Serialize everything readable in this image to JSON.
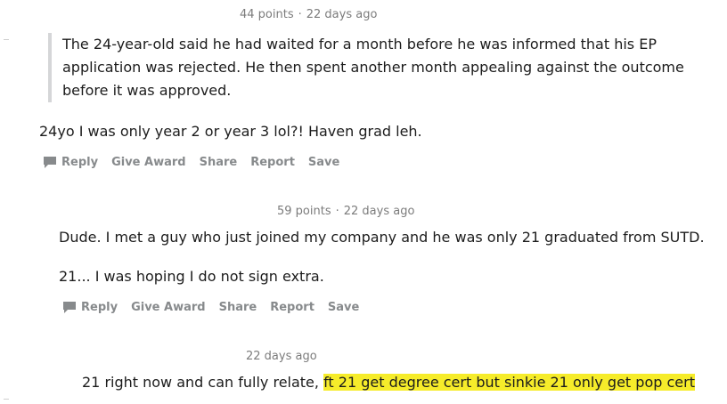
{
  "comments": [
    {
      "points": "44 points",
      "separator": "·",
      "time": "22 days ago",
      "quote": "The 24-year-old said he had waited for a month before he was informed that his EP application was rejected. He then spent another month appealing against the outcome before it was approved.",
      "text": "24yo I was only year 2 or year 3 lol?! Haven grad leh.",
      "actions": {
        "reply": "Reply",
        "give_award": "Give Award",
        "share": "Share",
        "report": "Report",
        "save": "Save"
      }
    },
    {
      "points": "59 points",
      "separator": "·",
      "time": "22 days ago",
      "para1": "Dude. I met a guy who just joined my company and he was only 21 graduated from SUTD.",
      "para2": "21... I was hoping I do not sign extra.",
      "actions": {
        "reply": "Reply",
        "give_award": "Give Award",
        "share": "Share",
        "report": "Report",
        "save": "Save"
      }
    },
    {
      "time": "22 days ago",
      "text_plain": "21 right now and can fully relate, ",
      "text_highlighted": "ft 21 get degree cert but sinkie 21 only get pop cert"
    }
  ],
  "colors": {
    "text": "#1c1c1c",
    "meta": "#7c7c7c",
    "action": "#878a8c",
    "quote_bar": "#d5d6d8",
    "highlight": "#f6ec2a"
  },
  "icons": {
    "reply": "speech-bubble-icon"
  }
}
